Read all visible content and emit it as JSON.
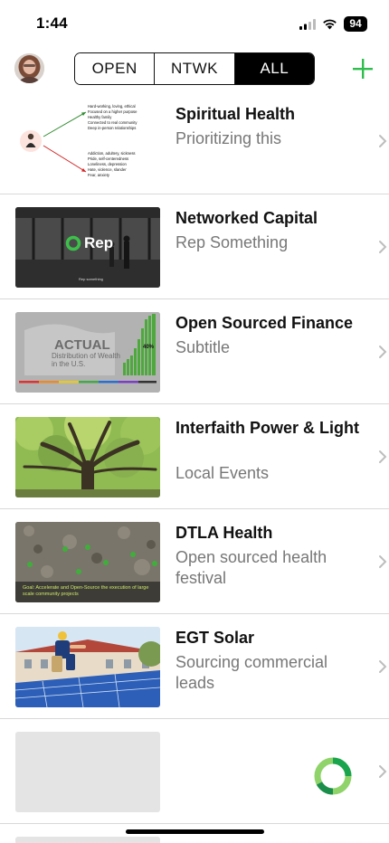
{
  "status": {
    "time": "1:44",
    "battery": "94"
  },
  "header": {
    "segments": [
      {
        "label": "OPEN",
        "active": false
      },
      {
        "label": "NTWK",
        "active": false
      },
      {
        "label": "ALL",
        "active": true
      }
    ],
    "add_icon": "plus-icon",
    "accent": "#2DBE4C"
  },
  "items": [
    {
      "title": "Spiritual Health",
      "subtitle": "Prioritizing this",
      "thumb": {
        "positives": [
          "Hard-working, loving, ethical",
          "Focused on a higher purpose",
          "Healthy family",
          "Connected to real community",
          "Deep in-person relationships"
        ],
        "negatives": [
          "Addiction, adultery, sickness",
          "Pride, self-centeredness",
          "Loneliness, depression",
          "Hate, violence, slander",
          "Fear, anxiety"
        ]
      }
    },
    {
      "title": "Networked Capital",
      "subtitle": "Rep Something",
      "thumb": {
        "logo": "Rep",
        "caption": "Rep something"
      }
    },
    {
      "title": "Open Sourced Finance",
      "subtitle": "Subtitle",
      "thumb": {
        "heading": "ACTUAL",
        "sub": "Distribution of Wealth in the U.S.",
        "percent": "40%"
      }
    },
    {
      "title": "Interfaith Power & Light",
      "subtitle": "Local Events"
    },
    {
      "title": "DTLA Health",
      "subtitle": "Open sourced health festival",
      "thumb": {
        "caption": "Goal: Accelerate and Open-Source the execution of large scale community projects"
      }
    },
    {
      "title": "EGT Solar",
      "subtitle": "Sourcing commercial leads"
    },
    {
      "title": "",
      "subtitle": ""
    }
  ]
}
